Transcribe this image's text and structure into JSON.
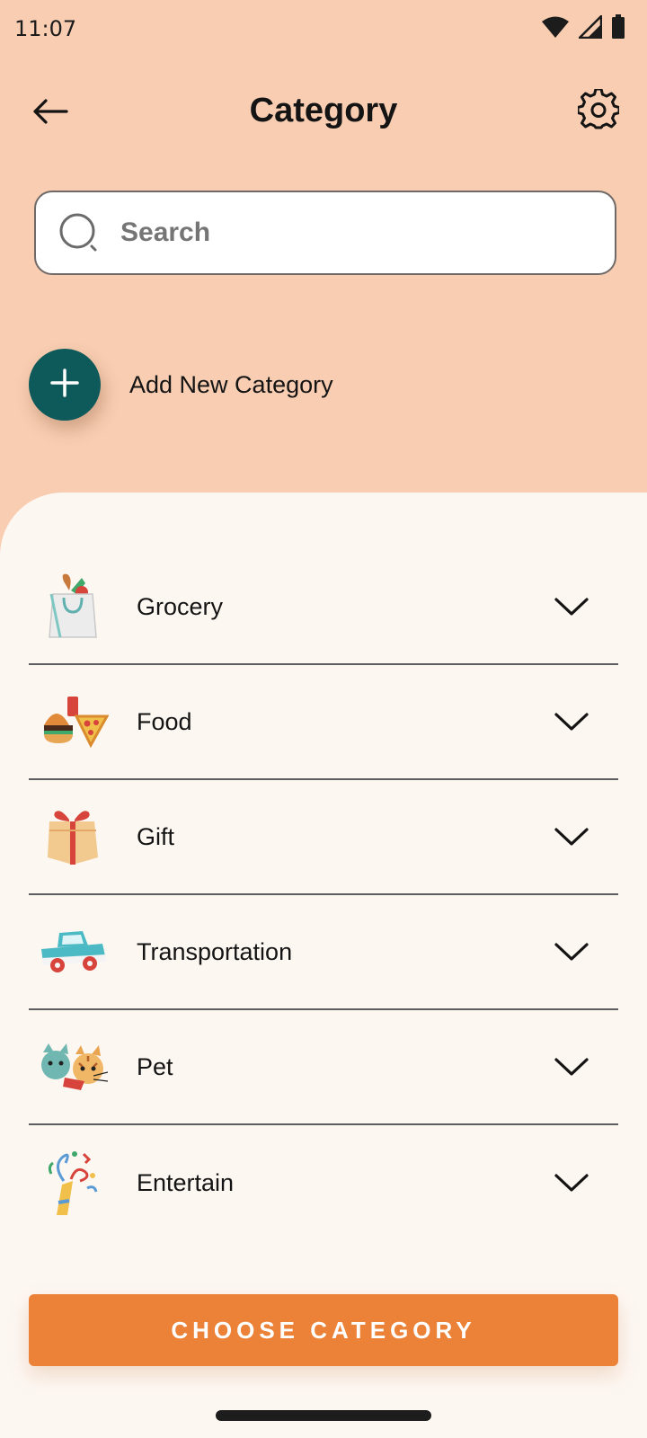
{
  "status_bar": {
    "time": "11:07",
    "icons": [
      "wifi-icon",
      "signal-icon",
      "battery-icon"
    ]
  },
  "header": {
    "title": "Category",
    "back_icon": "arrow-left-icon",
    "settings_icon": "gear-icon"
  },
  "search": {
    "placeholder": "Search",
    "value": ""
  },
  "add_category": {
    "label": "Add New Category",
    "icon": "plus-icon"
  },
  "categories": [
    {
      "label": "Grocery",
      "icon": "grocery-bag-icon"
    },
    {
      "label": "Food",
      "icon": "fast-food-icon"
    },
    {
      "label": "Gift",
      "icon": "gift-box-icon"
    },
    {
      "label": "Transportation",
      "icon": "car-icon"
    },
    {
      "label": "Pet",
      "icon": "pets-icon"
    },
    {
      "label": "Entertain",
      "icon": "party-popper-icon"
    }
  ],
  "footer": {
    "choose_label": "CHOOSE CATEGORY"
  },
  "colors": {
    "background": "#f8cdb1",
    "sheet": "#fdf7f2",
    "fab": "#0e5a5a",
    "primary_button": "#ec8238"
  }
}
